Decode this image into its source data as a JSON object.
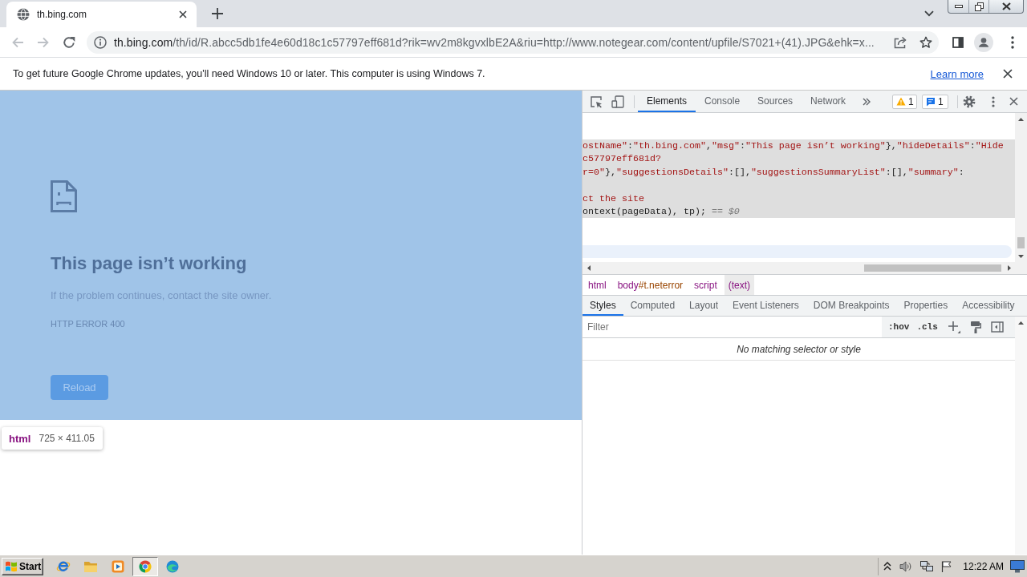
{
  "browser": {
    "tabs": [
      {
        "title": "th.bing.com",
        "selected": true
      }
    ],
    "navigation": {
      "back_disabled": true,
      "forward_disabled": true
    },
    "address_bar": {
      "host": "th.bing.com",
      "path": "/th/id/R.abcc5db1fe4e60d18c1c57797eff681d?rik=wv2m8kgvxlbE2A&riu=http://www.notegear.com/content/upfile/S7021+(41).JPG&ehk=x..."
    },
    "infobar": {
      "message": "To get future Google Chrome updates, you'll need Windows 10 or later. This computer is using Windows 7.",
      "link": "Learn more"
    }
  },
  "page": {
    "heading": "This page isn’t working",
    "message": "If the problem continues, contact the site owner.",
    "error_code": "HTTP ERROR 400",
    "reload_button": "Reload",
    "inspect_tooltip": {
      "tag": "html",
      "size": "725 × 411.05"
    }
  },
  "devtools": {
    "tabs": [
      {
        "label": "Elements",
        "selected": true
      },
      {
        "label": "Console",
        "selected": false
      },
      {
        "label": "Sources",
        "selected": false
      },
      {
        "label": "Network",
        "selected": false
      }
    ],
    "issues": {
      "warnings": "1",
      "messages": "1"
    },
    "dom_node": {
      "selected": true,
      "lines": [
        {
          "kind": "code",
          "segments": [
            {
              "kind": "string",
              "text": "ostName\""
            },
            {
              "kind": "punct",
              "text": ":"
            },
            {
              "kind": "string",
              "text": "\"th.bing.com\""
            },
            {
              "kind": "punct",
              "text": ","
            },
            {
              "kind": "string",
              "text": "\"msg\""
            },
            {
              "kind": "punct",
              "text": ":"
            },
            {
              "kind": "string",
              "text": "\"This page isn’t working\""
            },
            {
              "kind": "punct",
              "text": "},"
            },
            {
              "kind": "string",
              "text": "\"hideDetails\""
            },
            {
              "kind": "punct",
              "text": ":"
            },
            {
              "kind": "string",
              "text": "\"Hide"
            }
          ]
        },
        {
          "kind": "code",
          "segments": [
            {
              "kind": "string",
              "text": "c57797eff681d?"
            }
          ]
        },
        {
          "kind": "code",
          "segments": [
            {
              "kind": "string",
              "text": "r=0\""
            },
            {
              "kind": "punct",
              "text": "},"
            },
            {
              "kind": "string",
              "text": "\"suggestionsDetails\""
            },
            {
              "kind": "punct",
              "text": ":[],"
            },
            {
              "kind": "string",
              "text": "\"suggestionsSummaryList\""
            },
            {
              "kind": "punct",
              "text": ":[],"
            },
            {
              "kind": "string",
              "text": "\"summary\""
            },
            {
              "kind": "punct",
              "text": ":"
            }
          ]
        },
        {
          "kind": "blank"
        },
        {
          "kind": "code",
          "segments": [
            {
              "kind": "string",
              "text": "ct the site"
            }
          ]
        },
        {
          "kind": "code",
          "segments": [
            {
              "kind": "punct",
              "text": "ontext(pageData), tp);"
            },
            {
              "kind": "marker",
              "text": " == $0"
            }
          ]
        }
      ]
    },
    "breadcrumbs": [
      {
        "tag": "html",
        "selected": false
      },
      {
        "tag": "body",
        "suffix": "#t.neterror",
        "selected": false
      },
      {
        "tag": "script",
        "selected": false
      },
      {
        "tag": "(text)",
        "selected": true
      }
    ],
    "sidebar_tabs": [
      {
        "label": "Styles",
        "selected": true
      },
      {
        "label": "Computed",
        "selected": false
      },
      {
        "label": "Layout",
        "selected": false
      },
      {
        "label": "Event Listeners",
        "selected": false
      },
      {
        "label": "DOM Breakpoints",
        "selected": false
      },
      {
        "label": "Properties",
        "selected": false
      },
      {
        "label": "Accessibility",
        "selected": false
      }
    ],
    "styles": {
      "filter": {
        "placeholder": "Filter"
      },
      "toggles": [
        ":hov",
        ".cls"
      ],
      "empty_message": "No matching selector or style"
    }
  },
  "taskbar": {
    "start": "Start",
    "apps": [
      {
        "kind": "ie",
        "active": false
      },
      {
        "kind": "explorer",
        "active": false
      },
      {
        "kind": "media",
        "active": false
      },
      {
        "kind": "chrome",
        "active": true
      },
      {
        "kind": "edge",
        "active": false
      }
    ],
    "clock": "12:22 AM"
  }
}
